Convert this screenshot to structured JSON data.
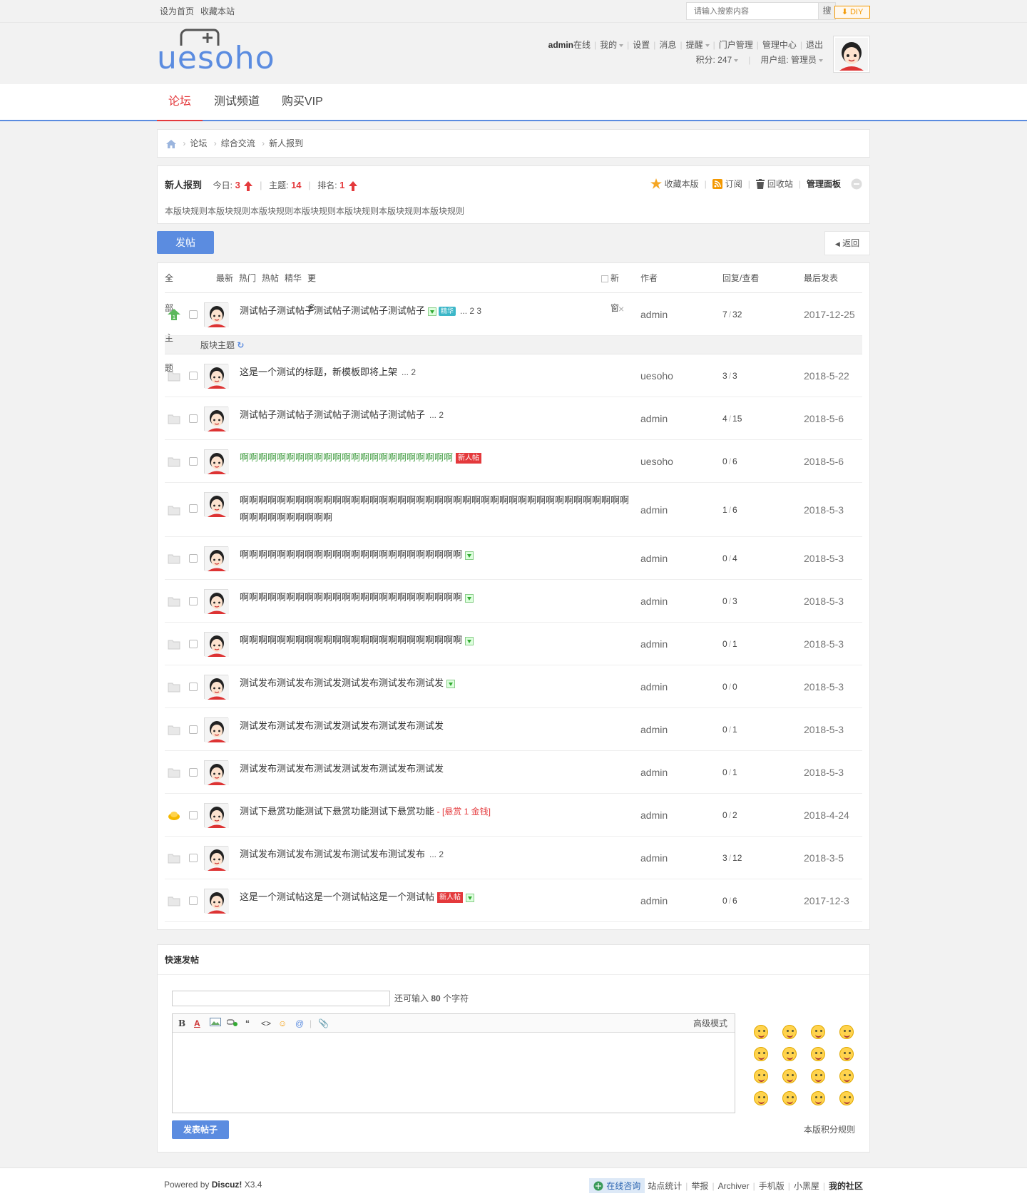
{
  "toolbar": {
    "links": [
      "设为首页",
      "收藏本站"
    ],
    "search_placeholder": "请输入搜索内容",
    "search_button": "搜",
    "diy": "DIY"
  },
  "header": {
    "logo": "uesoho",
    "user": "admin",
    "online": "在线",
    "menu": [
      "我的",
      "设置",
      "消息",
      "提醒",
      "门户管理",
      "管理中心",
      "退出"
    ],
    "credits_label": "积分: 247",
    "usergroup_label": "用户组: 管理员"
  },
  "nav": {
    "items": [
      "论坛",
      "测试频道",
      "购买VIP"
    ]
  },
  "breadcrumb": [
    "论坛",
    "综合交流",
    "新人报到"
  ],
  "forum": {
    "name": "新人报到",
    "today_label": "今日:",
    "today": "3",
    "threads_label": "主题:",
    "threads": "14",
    "rank_label": "排名:",
    "rank": "1",
    "rules": "本版块规则本版块规则本版块规则本版块规则本版块规则本版块规则本版块规则",
    "ops": [
      "收藏本版",
      "订阅",
      "回收站",
      "管理面板"
    ]
  },
  "actions": {
    "post": "发帖",
    "back": "返回"
  },
  "list_header": {
    "filters": [
      "全部主题",
      "最新",
      "热门",
      "热帖",
      "精华",
      "更多"
    ],
    "newwin": "新窗",
    "author": "作者",
    "replies": "回复/查看",
    "lastpost": "最后发表"
  },
  "section_label": "版块主题",
  "sticky": {
    "title": "测试帖子测试帖子测试帖子测试帖子测试帖子",
    "jing": "精华",
    "pages": "... 2  3",
    "author": "admin",
    "replies": "7",
    "views": "32",
    "date": "2017-12-25"
  },
  "threads": [
    {
      "title": "这是一个测试的标题，新模板即将上架",
      "pages": "... 2",
      "author": "uesoho",
      "replies": "3",
      "views": "3",
      "date": "2018-5-22"
    },
    {
      "title": "测试帖子测试帖子测试帖子测试帖子测试帖子",
      "pages": "... 2",
      "author": "admin",
      "replies": "4",
      "views": "15",
      "date": "2018-5-6"
    },
    {
      "title": "啊啊啊啊啊啊啊啊啊啊啊啊啊啊啊啊啊啊啊啊啊啊啊",
      "tag": "新人帖",
      "author": "uesoho",
      "replies": "0",
      "views": "6",
      "date": "2018-5-6"
    },
    {
      "title": "啊啊啊啊啊啊啊啊啊啊啊啊啊啊啊啊啊啊啊啊啊啊啊啊啊啊啊啊啊啊啊啊啊啊啊啊啊啊啊啊啊啊啊啊啊啊啊啊啊啊啊啊",
      "author": "admin",
      "replies": "1",
      "views": "6",
      "date": "2018-5-3"
    },
    {
      "title": "啊啊啊啊啊啊啊啊啊啊啊啊啊啊啊啊啊啊啊啊啊啊啊啊",
      "author": "admin",
      "replies": "0",
      "views": "4",
      "date": "2018-5-3"
    },
    {
      "title": "啊啊啊啊啊啊啊啊啊啊啊啊啊啊啊啊啊啊啊啊啊啊啊啊",
      "author": "admin",
      "replies": "0",
      "views": "3",
      "date": "2018-5-3"
    },
    {
      "title": "啊啊啊啊啊啊啊啊啊啊啊啊啊啊啊啊啊啊啊啊啊啊啊啊",
      "author": "admin",
      "replies": "0",
      "views": "1",
      "date": "2018-5-3"
    },
    {
      "title": "测试发布测试发布测试发测试发布测试发布测试发",
      "author": "admin",
      "replies": "0",
      "views": "0",
      "date": "2018-5-3"
    },
    {
      "title": "测试发布测试发布测试发测试发布测试发布测试发",
      "author": "admin",
      "replies": "0",
      "views": "1",
      "date": "2018-5-3"
    },
    {
      "title": "测试发布测试发布测试发测试发布测试发布测试发",
      "author": "admin",
      "replies": "0",
      "views": "1",
      "date": "2018-5-3"
    },
    {
      "title": "测试下悬赏功能测试下悬赏功能测试下悬赏功能",
      "bounty": "- [悬赏 1 金钱]",
      "author": "admin",
      "replies": "0",
      "views": "2",
      "date": "2018-4-24"
    },
    {
      "title": "测试发布测试发布测试发布测试发布测试发布",
      "pages": "... 2",
      "author": "admin",
      "replies": "3",
      "views": "12",
      "date": "2018-3-5"
    },
    {
      "title": "这是一个测试帖这是一个测试帖这是一个测试帖",
      "tag": "新人帖",
      "author": "admin",
      "replies": "0",
      "views": "6",
      "date": "2017-12-3"
    }
  ],
  "quickpost": {
    "title": "快速发帖",
    "remain_prefix": "还可输入",
    "remain_count": "80",
    "remain_suffix": "个字符",
    "advanced": "高级模式",
    "toolbar": [
      "B",
      "A"
    ],
    "submit": "发表帖子",
    "credit_rules": "本版积分规则"
  },
  "footer": {
    "powered_prefix": "Powered by",
    "powered_brand": "Discuz!",
    "version": "X3.4",
    "online_consult": "在线咨询",
    "links": [
      "站点统计",
      "举报",
      "Archiver",
      "手机版",
      "小黑屋"
    ],
    "community": "我的社区"
  }
}
